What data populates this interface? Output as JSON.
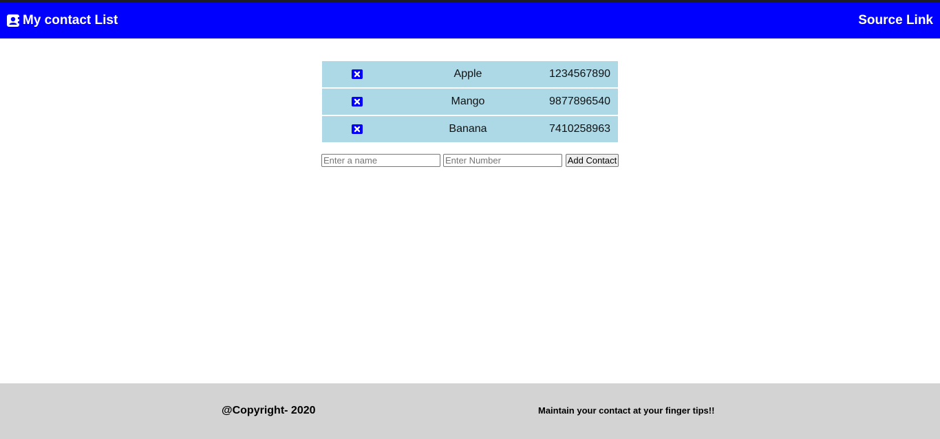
{
  "header": {
    "title": "My contact List",
    "title_icon": "contact-book-icon",
    "source_link": "Source Link"
  },
  "contacts": [
    {
      "name": "Apple",
      "number": "1234567890",
      "delete_icon": "close-square-icon"
    },
    {
      "name": "Mango",
      "number": "9877896540",
      "delete_icon": "close-square-icon"
    },
    {
      "name": "Banana",
      "number": "7410258963",
      "delete_icon": "close-square-icon"
    }
  ],
  "form": {
    "name_placeholder": "Enter a name",
    "number_placeholder": "Enter Number",
    "add_button_label": "Add Contact"
  },
  "footer": {
    "copyright": "@Copyright- 2020",
    "tagline": "Maintain your contact at your finger tips!!"
  },
  "colors": {
    "header_bg": "#0000ff",
    "row_bg": "#add8e6",
    "footer_bg": "#d3d3d3",
    "icon": "#0000ff"
  }
}
